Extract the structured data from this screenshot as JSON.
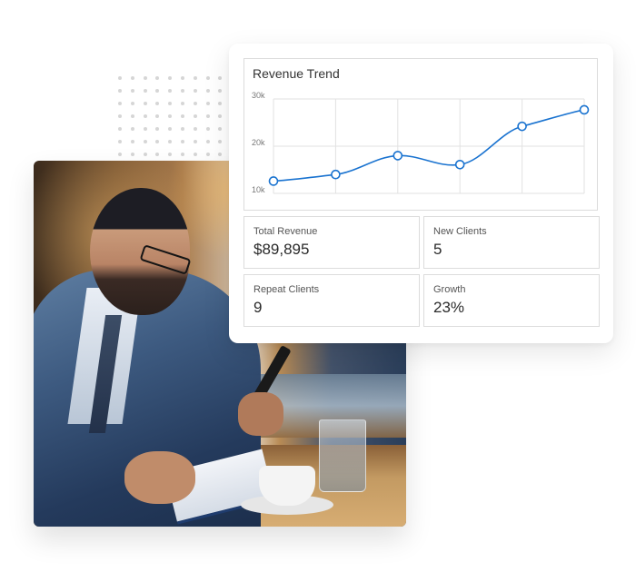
{
  "card": {
    "stats": [
      {
        "label": "Total Revenue",
        "value": "$89,895"
      },
      {
        "label": "New Clients",
        "value": "5"
      },
      {
        "label": "Repeat Clients",
        "value": "9"
      },
      {
        "label": "Growth",
        "value": "23%"
      }
    ]
  },
  "photo": {
    "description": "Businessman in suit with glasses writing in notebook and holding phone at cafe table with coffee cup and glass of water"
  },
  "colors": {
    "line": "#1a73d0",
    "grid": "#e2e2e2",
    "tick_text": "#777777"
  },
  "chart_data": {
    "type": "line",
    "title": "Revenue Trend",
    "xlabel": "",
    "ylabel": "",
    "x": [
      1,
      2,
      3,
      4,
      5,
      6
    ],
    "series": [
      {
        "name": "Revenue",
        "values": [
          12600,
          14000,
          18000,
          16100,
          24200,
          27700
        ]
      }
    ],
    "ylim": [
      10000,
      30000
    ],
    "yticks": [
      {
        "value": 10000,
        "label": "10k"
      },
      {
        "value": 20000,
        "label": "20k"
      },
      {
        "value": 30000,
        "label": "30k"
      }
    ],
    "xtick_labels": [],
    "grid": true,
    "smooth": true,
    "legend": "none"
  }
}
